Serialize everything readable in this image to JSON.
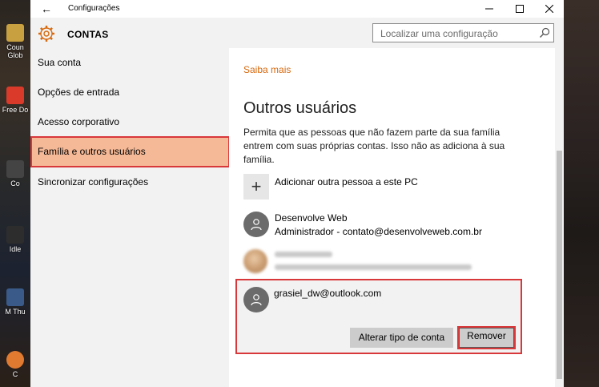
{
  "window": {
    "title": "Configurações",
    "back_icon": "←",
    "minimize_icon": "—",
    "maximize_icon": "☐",
    "close_icon": "✕"
  },
  "header": {
    "section_name": "CONTAS",
    "search_placeholder": "Localizar uma configuração",
    "accent_color": "#d7690e"
  },
  "sidebar": {
    "items": [
      {
        "label": "Sua conta"
      },
      {
        "label": "Opções de entrada"
      },
      {
        "label": "Acesso corporativo"
      },
      {
        "label": "Família e outros usuários",
        "selected": true
      },
      {
        "label": "Sincronizar configurações"
      }
    ],
    "selected_color": "#f6b997",
    "highlight_border": "#d9383a"
  },
  "content": {
    "saiba_mais": "Saiba mais",
    "section_title": "Outros usuários",
    "description": "Permita que as pessoas que não fazem parte da sua família entrem com suas próprias contas. Isso não as adiciona à sua família.",
    "add_label": "Adicionar outra pessoa a este PC",
    "users": [
      {
        "name": "Desenvolve Web",
        "detail": "Administrador - contato@desenvolveweb.com.br"
      },
      {
        "name": "grasiel_dw@outlook.com",
        "detail": ""
      }
    ],
    "buttons": {
      "change_type": "Alterar tipo de conta",
      "remove": "Remover"
    }
  },
  "desktop": {
    "icons": [
      {
        "label": "Coun Glob",
        "color": "#c8a040"
      },
      {
        "label": "Free Do",
        "color": "#d93a2a"
      },
      {
        "label": "Co",
        "color": "#444444"
      },
      {
        "label": "Idle",
        "color": "#2d2d2d"
      },
      {
        "label": "M Thu",
        "color": "#3a5a8a"
      },
      {
        "label": "C",
        "color": "#e07a30"
      }
    ]
  }
}
